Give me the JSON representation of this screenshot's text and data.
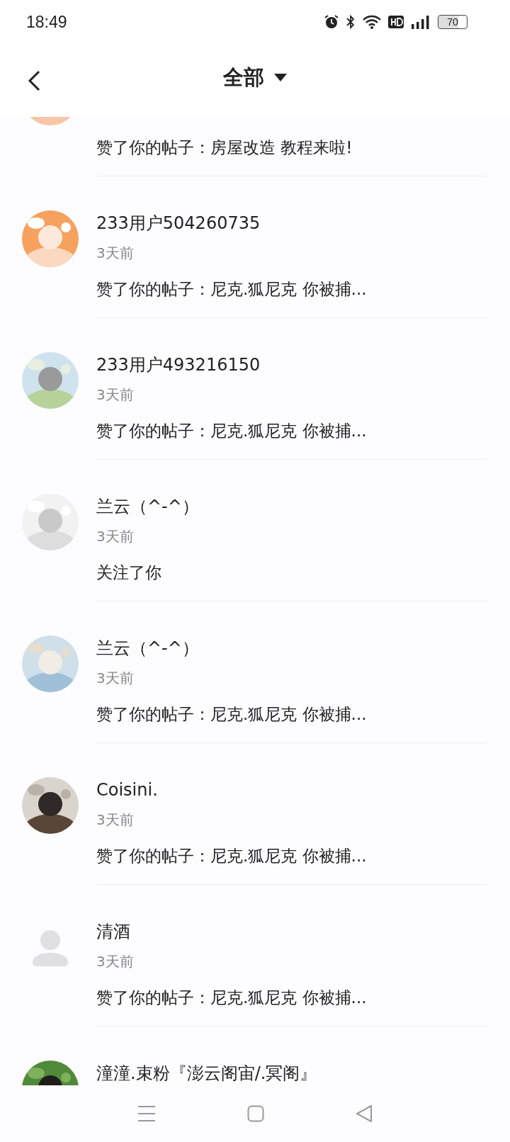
{
  "status_bar": {
    "time": "18:49",
    "battery": "70"
  },
  "top_bar": {
    "title": "全部"
  },
  "notifications": [
    {
      "message": "赞了你的帖子：房屋改造 教程来啦!"
    },
    {
      "name": "233用户504260735",
      "time": "3天前",
      "message": "赞了你的帖子：尼克.狐尼克 你被捕..."
    },
    {
      "name": "233用户493216150",
      "time": "3天前",
      "message": "赞了你的帖子：尼克.狐尼克 你被捕..."
    },
    {
      "name": "兰云（^-^）",
      "time": "3天前",
      "message": "关注了你"
    },
    {
      "name": "兰云（^-^）",
      "time": "3天前",
      "message": "赞了你的帖子：尼克.狐尼克 你被捕..."
    },
    {
      "name": "Coisini.",
      "time": "3天前",
      "message": "赞了你的帖子：尼克.狐尼克 你被捕..."
    },
    {
      "avatar": {
        "kind": "default"
      },
      "name": "清酒",
      "time": "3天前",
      "message": "赞了你的帖子：尼克.狐尼克 你被捕..."
    },
    {
      "name": "潼潼.束粉『澎云阁宙/.冥阁』"
    }
  ]
}
